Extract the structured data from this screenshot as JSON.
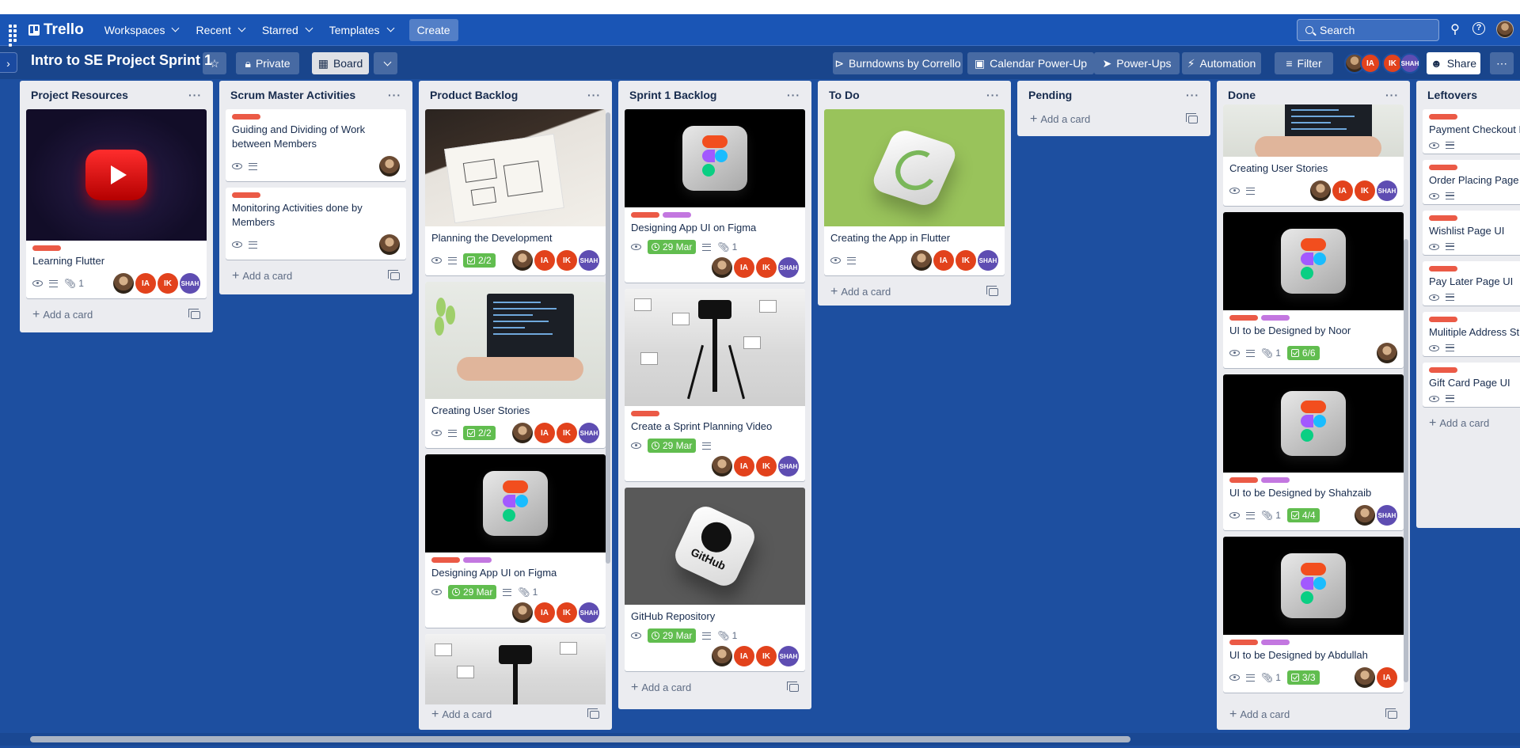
{
  "app": {
    "logo": "Trello"
  },
  "topbar": {
    "nav": [
      "Workspaces",
      "Recent",
      "Starred",
      "Templates"
    ],
    "create_label": "Create",
    "search_placeholder": "Search"
  },
  "board": {
    "title": "Intro to SE Project Sprint 1",
    "visibility": "Private",
    "view": "Board",
    "powerups": [
      "Burndowns by Corrello",
      "Calendar Power-Up",
      "Power-Ups",
      "Automation"
    ],
    "filter_label": "Filter",
    "share_label": "Share",
    "members": [
      "IA",
      "IK",
      "SHAH"
    ]
  },
  "add_card_label": "Add a card",
  "lists": [
    {
      "title": "Project Resources",
      "cards": [
        {
          "title": "Learning Flutter",
          "attachments": "1",
          "members": [
            "photo",
            "IA",
            "IK",
            "SHAH"
          ]
        }
      ]
    },
    {
      "title": "Scrum Master Activities",
      "cards": [
        {
          "title": "Guiding and Dividing of Work between Members"
        },
        {
          "title": "Monitoring Activities done by Members"
        }
      ]
    },
    {
      "title": "Product Backlog",
      "cards": [
        {
          "title": "Planning the Development",
          "checklist": "2/2"
        },
        {
          "title": "Creating User Stories",
          "checklist": "2/2"
        },
        {
          "title": "Designing App UI on Figma",
          "due": "29 Mar",
          "attachments": "1"
        }
      ]
    },
    {
      "title": "Sprint 1 Backlog",
      "cards": [
        {
          "title": "Designing App UI on Figma",
          "due": "29 Mar",
          "attachments": "1"
        },
        {
          "title": "Create a Sprint Planning Video",
          "due": "29 Mar"
        },
        {
          "title": "GitHub Repository",
          "due": "29 Mar",
          "attachments": "1"
        }
      ]
    },
    {
      "title": "To Do",
      "cards": [
        {
          "title": "Creating the App in Flutter"
        }
      ]
    },
    {
      "title": "Pending",
      "cards": []
    },
    {
      "title": "Done",
      "cards": [
        {
          "title": "Creating User Stories"
        },
        {
          "title": "UI to be Designed by Noor",
          "attachments": "1",
          "checklist": "6/6"
        },
        {
          "title": "UI to be Designed by Shahzaib",
          "attachments": "1",
          "checklist": "4/4"
        },
        {
          "title": "UI to be Designed by Abdullah",
          "attachments": "1",
          "checklist": "3/3"
        }
      ]
    },
    {
      "title": "Leftovers",
      "cards": [
        {
          "title": "Payment Checkout Pa"
        },
        {
          "title": "Order Placing Page U"
        },
        {
          "title": "Wishlist Page UI"
        },
        {
          "title": "Pay Later Page UI"
        },
        {
          "title": "Mulitiple Address Str"
        },
        {
          "title": "Gift Card Page UI"
        }
      ]
    }
  ],
  "colors": {
    "label_red": "#eb5a46",
    "label_purple": "#c377e0",
    "badge_green": "#61bd4f",
    "member_ia": "#e2421c",
    "member_shah": "#5e4db2"
  }
}
